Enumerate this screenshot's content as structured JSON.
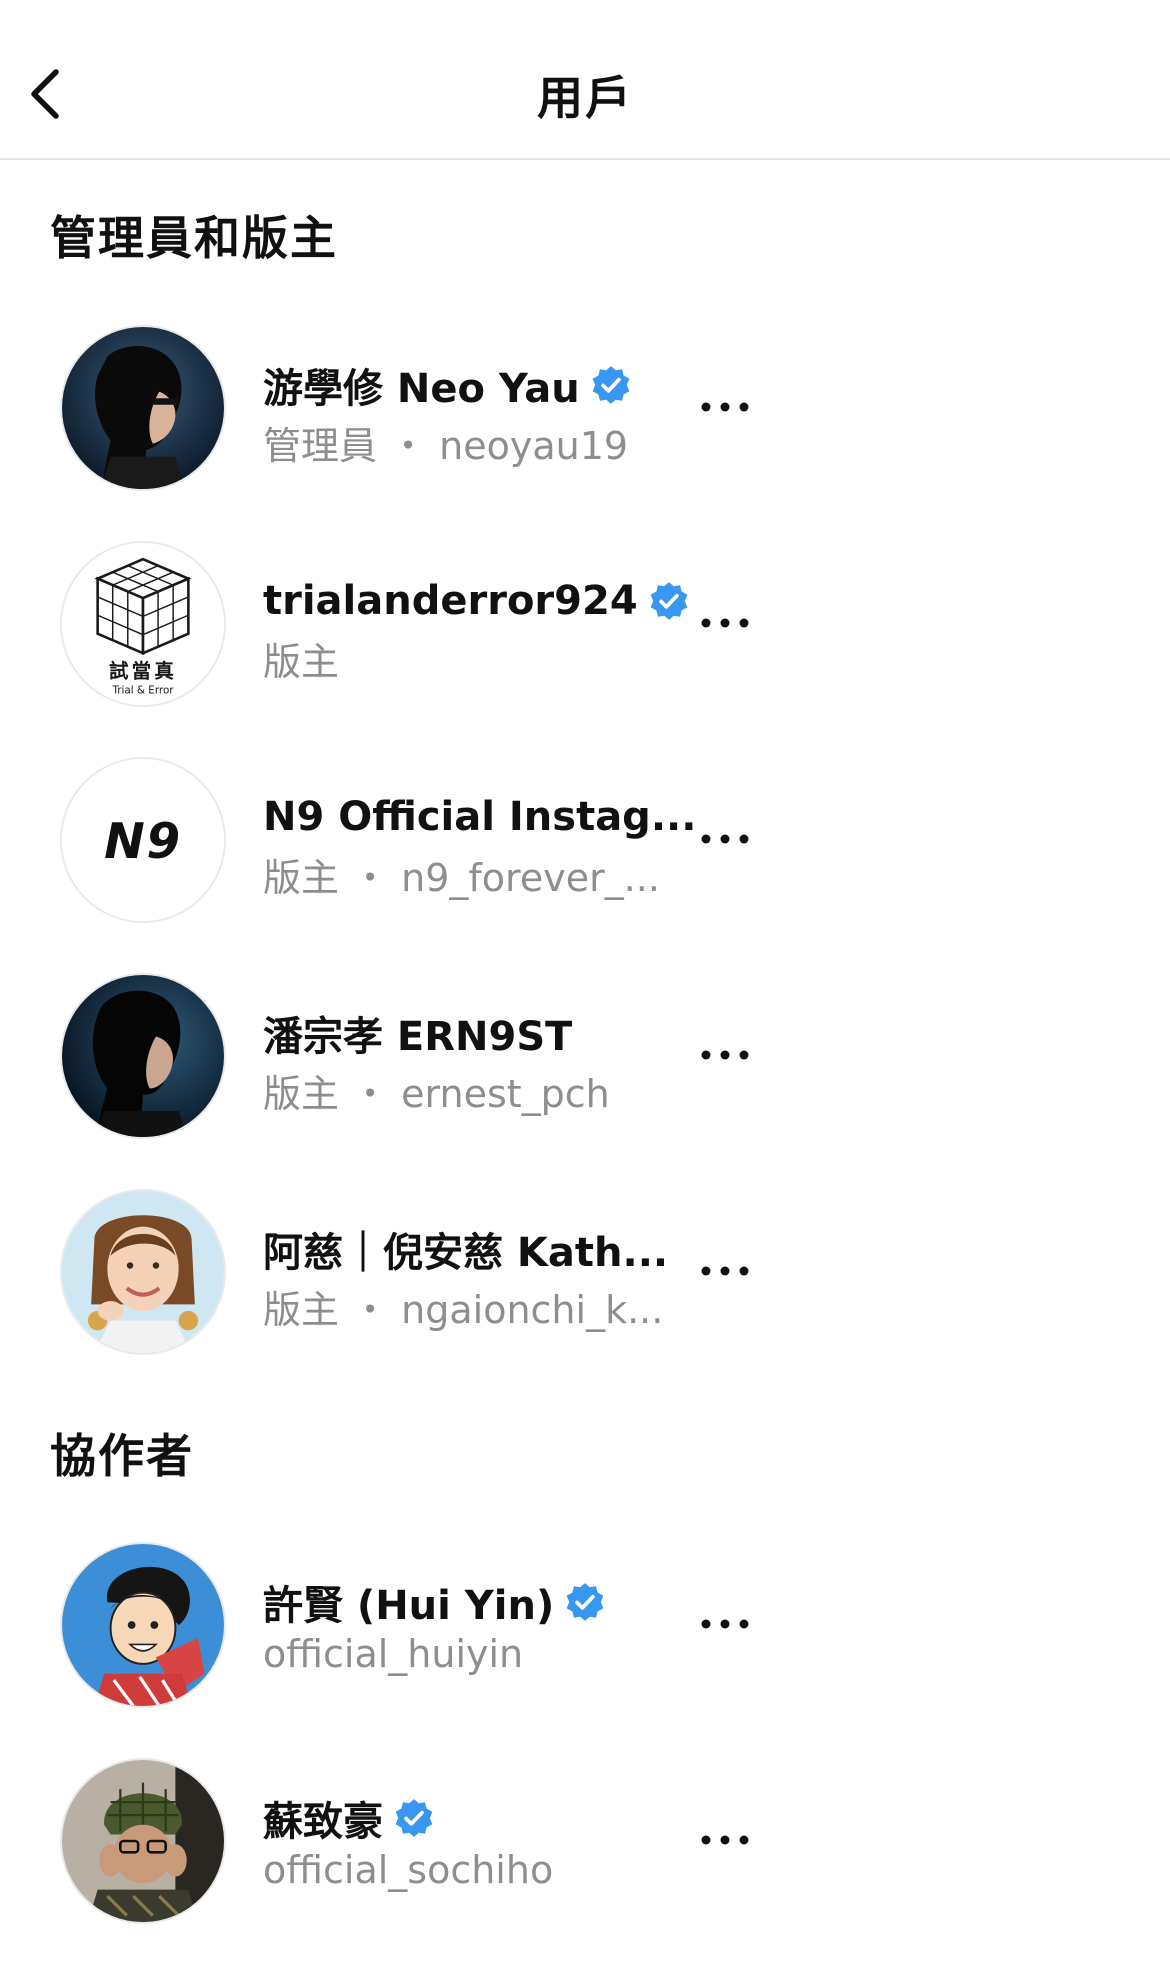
{
  "header": {
    "title": "用戶"
  },
  "sections": {
    "admins": {
      "title": "管理員和版主"
    },
    "collaborators": {
      "title": "協作者"
    }
  },
  "admins": [
    {
      "name": "游學修 Neo Yau",
      "sub": "管理員 ・ neoyau19",
      "verified": true,
      "avatar": "dark-portrait"
    },
    {
      "name": "trialanderror924",
      "sub": "版主",
      "verified": true,
      "avatar": "cube-logo",
      "logo_text_1": "試當真",
      "logo_text_2": "Trial & Error"
    },
    {
      "name": "N9 Official Instag...",
      "sub": "版主 ・ n9_forever_...",
      "verified": false,
      "avatar": "n9-logo",
      "logo_text": "N9"
    },
    {
      "name": "潘宗孝 ERN9ST",
      "sub": "版主 ・ ernest_pch",
      "verified": false,
      "avatar": "dark-portrait"
    },
    {
      "name": "阿慈｜倪安慈 Kath...",
      "sub": "版主 ・ ngaionchi_k...",
      "verified": false,
      "avatar": "light-portrait"
    }
  ],
  "collaborators": [
    {
      "name": "許賢 (Hui Yin)",
      "sub": "official_huiyin",
      "verified": true,
      "avatar": "cartoon"
    },
    {
      "name": "蘇致豪",
      "sub": "official_sochiho",
      "verified": true,
      "avatar": "hat-portrait"
    }
  ],
  "colors": {
    "verified": "#3897f0",
    "subtext": "#8e8e8e",
    "divider": "#e6e6e6"
  },
  "icons": {
    "back": "chevron-left-icon",
    "more": "more-horizontal-icon",
    "verified": "verified-badge-icon"
  }
}
